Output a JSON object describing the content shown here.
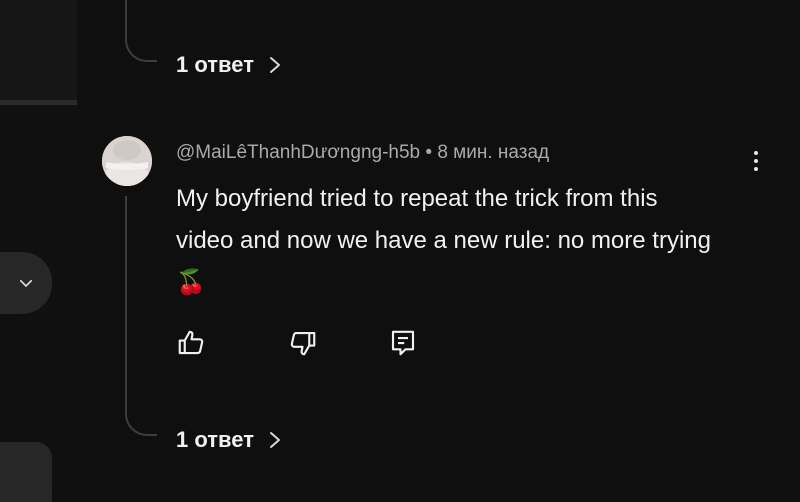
{
  "thread_top": {
    "replies_label": "1 ответ"
  },
  "comment": {
    "author": "@MaiLêThanhDươngng-h5b",
    "separator": "•",
    "time": "8 мин. назад",
    "text": "My boyfriend tried to repeat the trick from this video and now we have a new rule: no more trying",
    "emoji": "🍒",
    "actions": {
      "like_icon": "thumb-up-icon",
      "dislike_icon": "thumb-down-icon",
      "reply_icon": "reply-icon"
    },
    "menu_icon": "more-vert-icon",
    "replies_label": "1 ответ"
  },
  "colors": {
    "background": "#0f0f0f",
    "text_primary": "#f1f1f1",
    "text_secondary": "#aaaaaa",
    "thread_line": "#3d3d3d"
  }
}
